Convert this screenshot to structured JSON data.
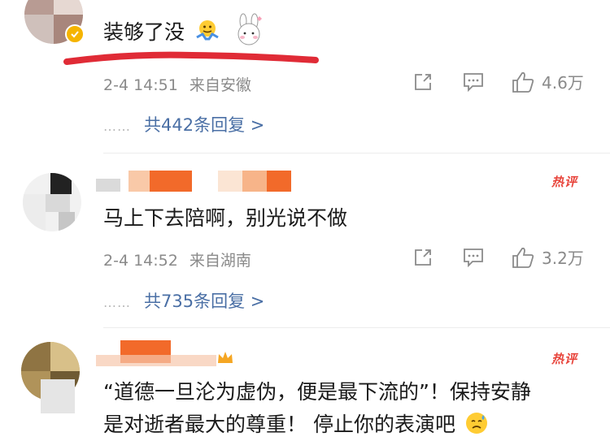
{
  "comments": [
    {
      "text": "装够了没",
      "time": "2-4 14:51",
      "location": "来自安徽",
      "likes": "4.6万",
      "replies_label": "共442条回复 >",
      "hot_badge": ""
    },
    {
      "text": "马上下去陪啊，别光说不做",
      "time": "2-4 14:52",
      "location": "来自湖南",
      "likes": "3.2万",
      "replies_label": "共735条回复 >",
      "hot_badge": "热评"
    },
    {
      "text_line1": "“道德一旦沦为虚伪，便是最下流的”！保持安静",
      "text_line2": "是对逝者最大的尊重！ 停止你的表演吧",
      "hot_badge": "热评"
    }
  ],
  "dots": "……",
  "colors": {
    "reply_link": "#4a6fa5",
    "meta_gray": "#8a8a8a",
    "hot_red": "#e8453c",
    "underline_red": "#e02b36",
    "blur_orange": "#f26a2a"
  },
  "icons": [
    "emoji-shrug-icon",
    "bunny-sticker-icon",
    "verified-badge-icon",
    "share-icon",
    "comment-icon",
    "thumb-up-icon",
    "crown-icon"
  ]
}
